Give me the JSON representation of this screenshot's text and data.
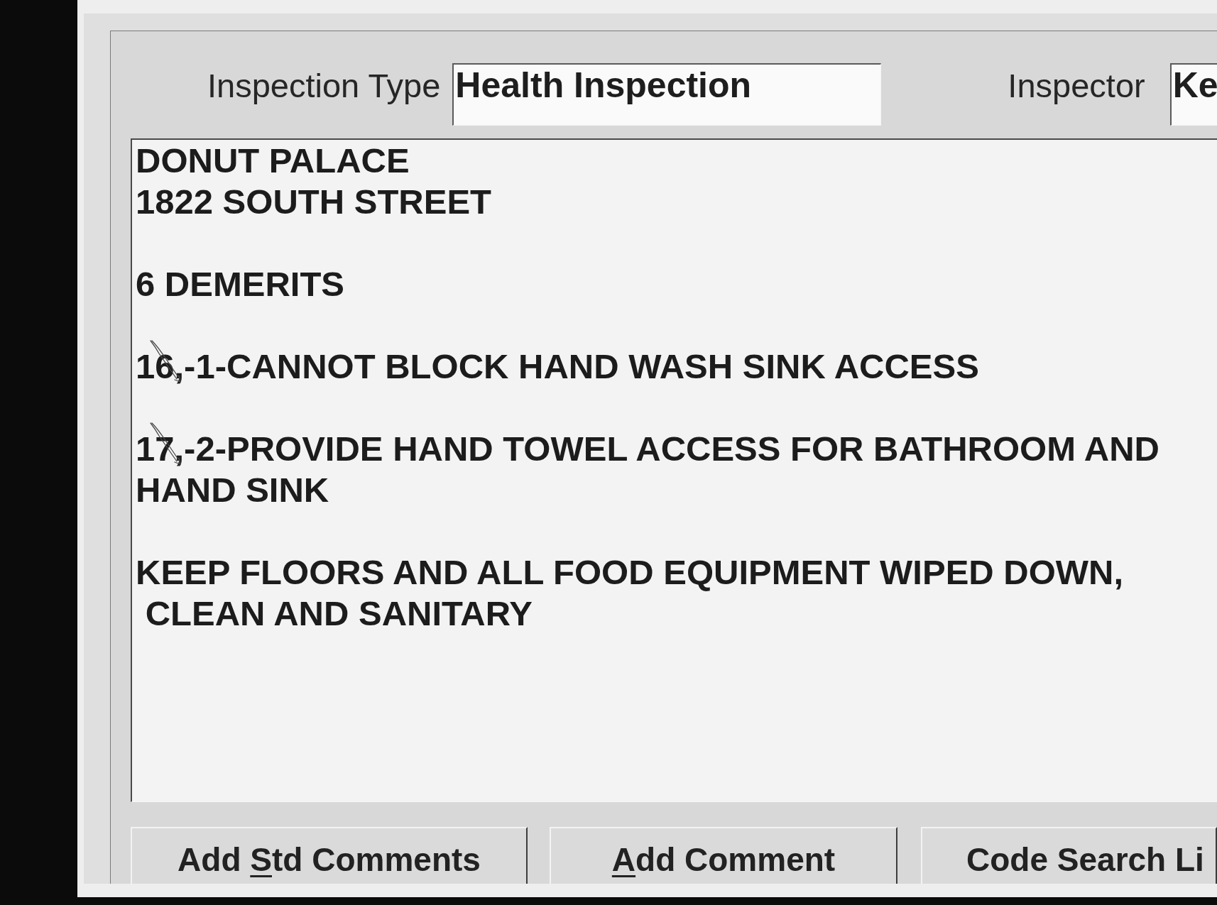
{
  "inspection_type": {
    "label": "Inspection Type",
    "value": "Health Inspection"
  },
  "inspector": {
    "label": "Inspector",
    "value": "Ke"
  },
  "comments": [
    {
      "text": "DONUT PALACE\n1822 SOUTH STREET",
      "hand_ticked": false
    },
    {
      "text": "6 DEMERITS",
      "hand_ticked": false
    },
    {
      "text": "16,-1-CANNOT BLOCK HAND WASH SINK ACCESS",
      "hand_ticked": true
    },
    {
      "text": "17,-2-PROVIDE HAND TOWEL ACCESS FOR BATHROOM AND HAND SINK",
      "hand_ticked": true
    },
    {
      "text": "KEEP FLOORS AND ALL FOOD EQUIPMENT WIPED DOWN,\n CLEAN AND SANITARY",
      "hand_ticked": false
    }
  ],
  "buttons": [
    {
      "label_parts": [
        {
          "text": "Add ",
          "underlined": false
        },
        {
          "text": "S",
          "underlined": true
        },
        {
          "text": "td Comments",
          "underlined": false
        }
      ]
    },
    {
      "label_parts": [
        {
          "text": "A",
          "underlined": true
        },
        {
          "text": "dd Comment",
          "underlined": false
        }
      ]
    },
    {
      "label_parts": [
        {
          "text": "Code Search Li",
          "underlined": false
        }
      ]
    }
  ]
}
